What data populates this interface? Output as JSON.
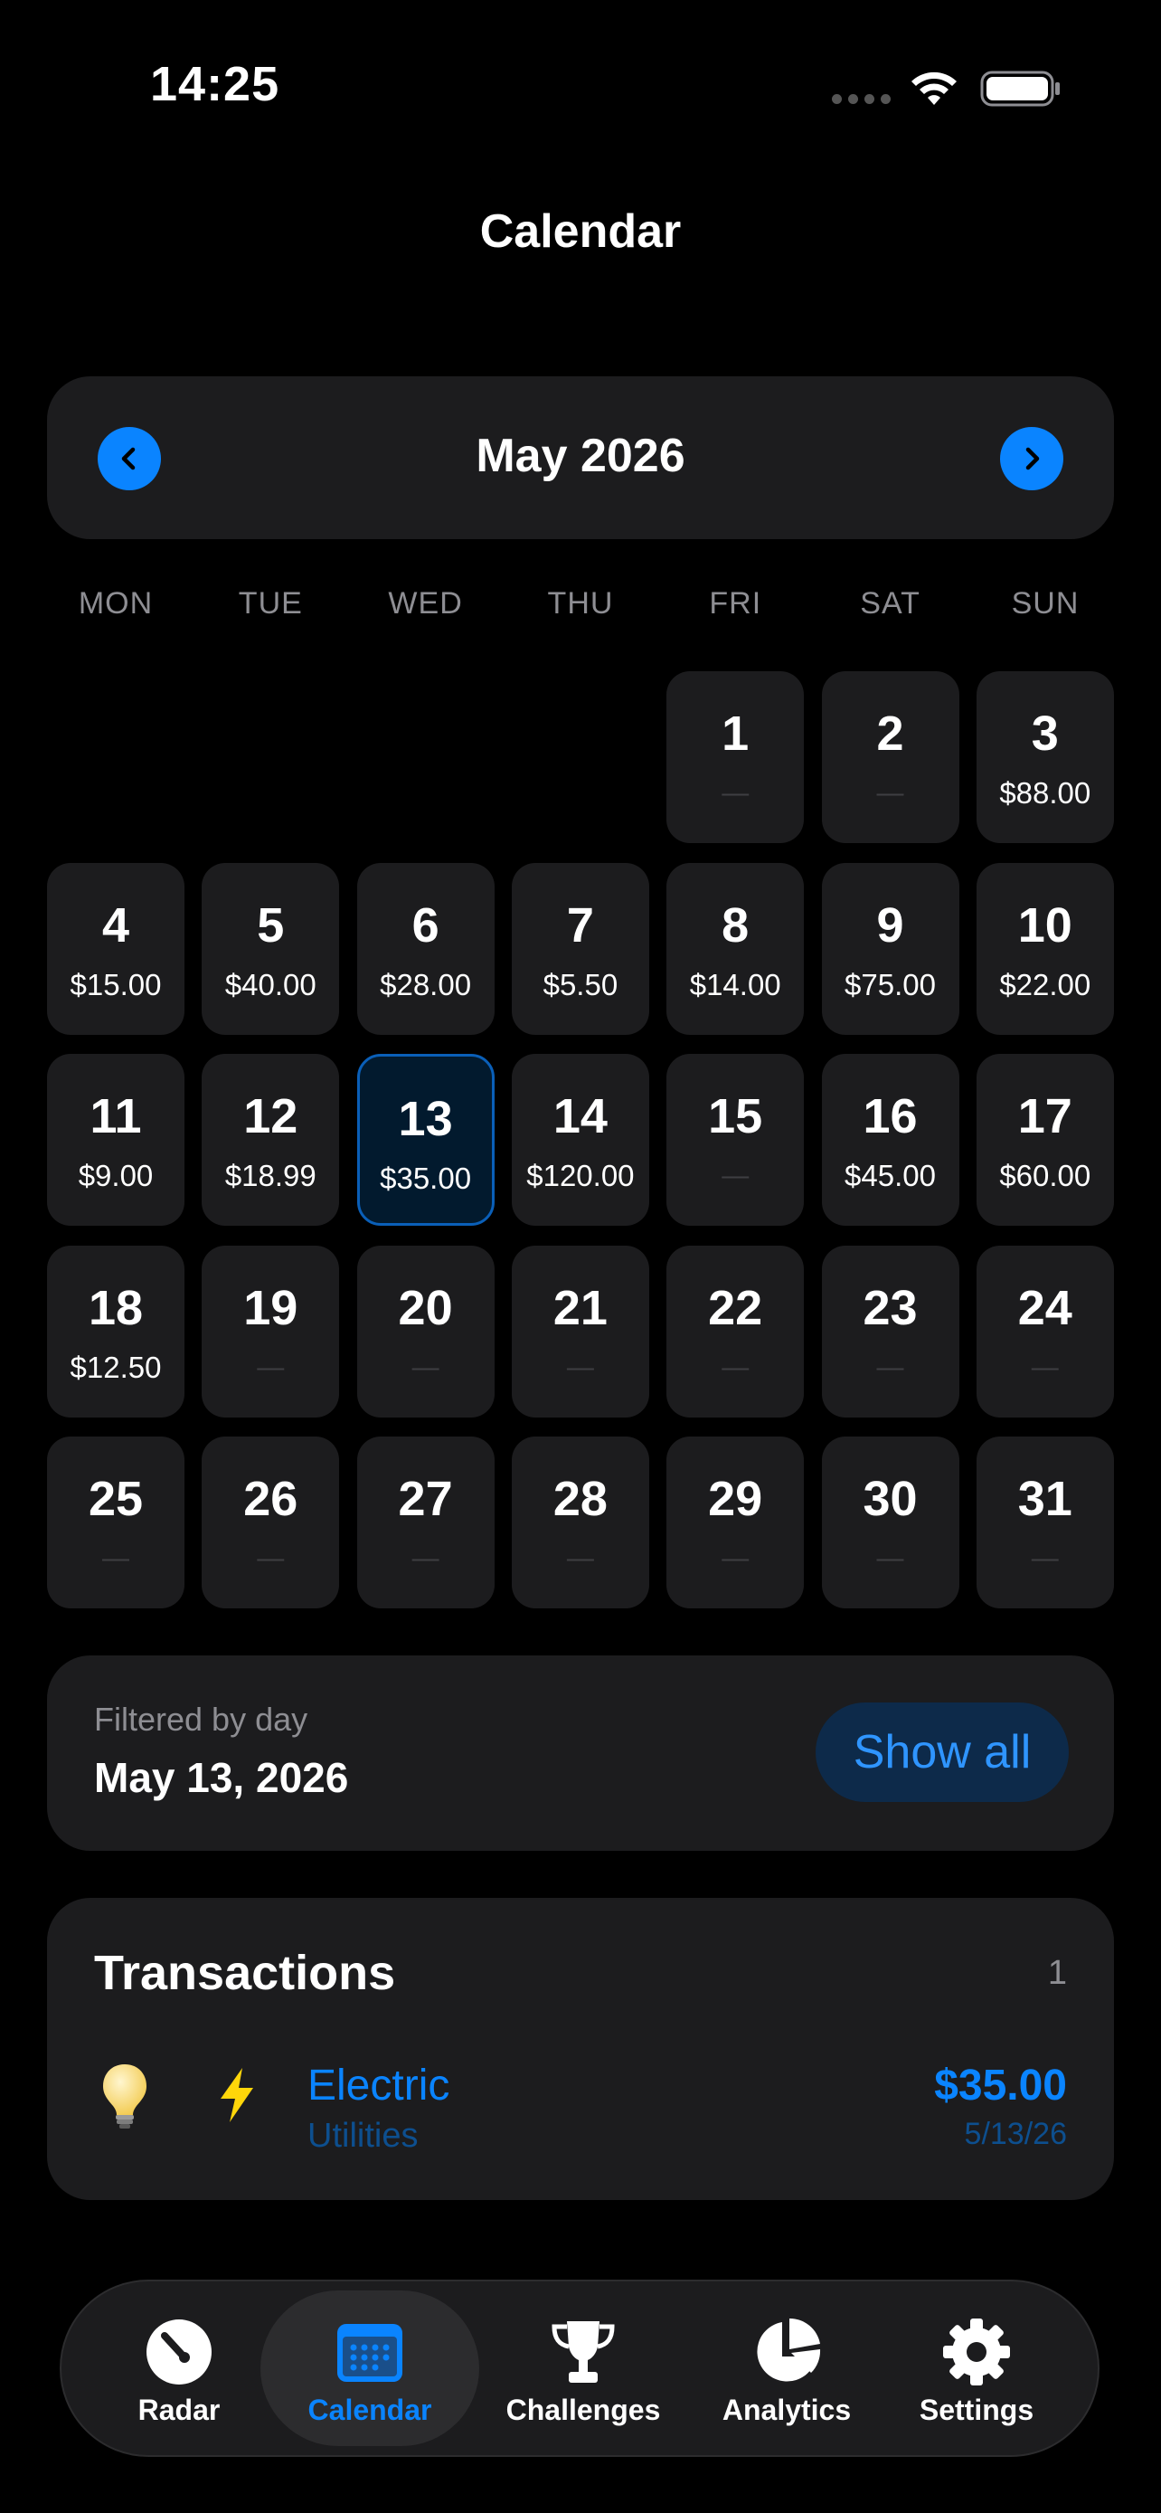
{
  "status_bar": {
    "time": "14:25"
  },
  "header": {
    "title": "Calendar"
  },
  "month_nav": {
    "label": "May 2026",
    "prev_icon": "chevron-left-icon",
    "next_icon": "chevron-right-icon"
  },
  "weekdays": [
    "MON",
    "TUE",
    "WED",
    "THU",
    "FRI",
    "SAT",
    "SUN"
  ],
  "calendar": {
    "days": [
      {
        "day": "1",
        "amount": "—"
      },
      {
        "day": "2",
        "amount": "—"
      },
      {
        "day": "3",
        "amount": "$88.00"
      },
      {
        "day": "4",
        "amount": "$15.00"
      },
      {
        "day": "5",
        "amount": "$40.00"
      },
      {
        "day": "6",
        "amount": "$28.00"
      },
      {
        "day": "7",
        "amount": "$5.50"
      },
      {
        "day": "8",
        "amount": "$14.00"
      },
      {
        "day": "9",
        "amount": "$75.00"
      },
      {
        "day": "10",
        "amount": "$22.00"
      },
      {
        "day": "11",
        "amount": "$9.00"
      },
      {
        "day": "12",
        "amount": "$18.99"
      },
      {
        "day": "13",
        "amount": "$35.00",
        "selected": true
      },
      {
        "day": "14",
        "amount": "$120.00"
      },
      {
        "day": "15",
        "amount": "—"
      },
      {
        "day": "16",
        "amount": "$45.00"
      },
      {
        "day": "17",
        "amount": "$60.00"
      },
      {
        "day": "18",
        "amount": "$12.50"
      },
      {
        "day": "19",
        "amount": "—"
      },
      {
        "day": "20",
        "amount": "—"
      },
      {
        "day": "21",
        "amount": "—"
      },
      {
        "day": "22",
        "amount": "—"
      },
      {
        "day": "23",
        "amount": "—"
      },
      {
        "day": "24",
        "amount": "—"
      },
      {
        "day": "25",
        "amount": "—"
      },
      {
        "day": "26",
        "amount": "—"
      },
      {
        "day": "27",
        "amount": "—"
      },
      {
        "day": "28",
        "amount": "—"
      },
      {
        "day": "29",
        "amount": "—"
      },
      {
        "day": "30",
        "amount": "—"
      },
      {
        "day": "31",
        "amount": "—"
      }
    ]
  },
  "filter": {
    "caption": "Filtered by day",
    "date": "May 13, 2026",
    "show_all_label": "Show all"
  },
  "transactions": {
    "title": "Transactions",
    "count": "1",
    "items": [
      {
        "name": "Electric",
        "category": "Utilities",
        "amount": "$35.00",
        "date": "5/13/26",
        "icon": "lightbulb-icon",
        "category_icon": "bolt-icon"
      }
    ]
  },
  "tab_bar": {
    "items": [
      {
        "label": "Radar",
        "icon": "gauge-icon"
      },
      {
        "label": "Calendar",
        "icon": "calendar-icon",
        "active": true
      },
      {
        "label": "Challenges",
        "icon": "trophy-icon"
      },
      {
        "label": "Analytics",
        "icon": "pie-chart-icon"
      },
      {
        "label": "Settings",
        "icon": "gear-icon"
      }
    ]
  },
  "colors": {
    "accent": "#0a84ff",
    "card": "#1c1c1e",
    "background": "#000000",
    "muted": "#8e8e93"
  }
}
